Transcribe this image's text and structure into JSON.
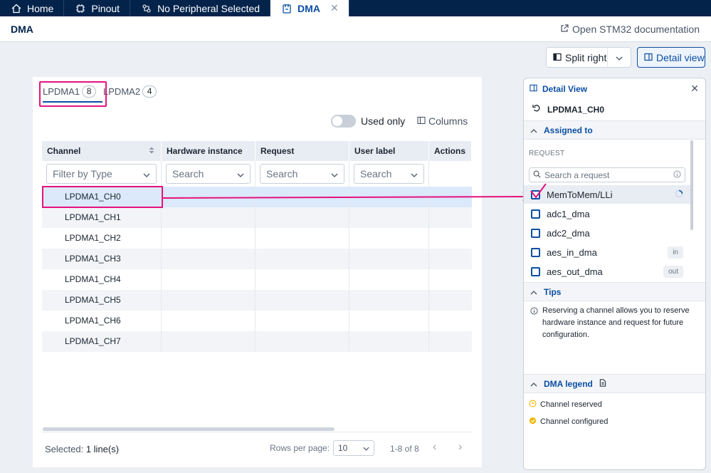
{
  "top_tabs": [
    {
      "label": "Home",
      "icon": "home-icon"
    },
    {
      "label": "Pinout",
      "icon": "chip-icon"
    },
    {
      "label": "No Peripheral Selected",
      "icon": "peripheral-icon"
    },
    {
      "label": "DMA",
      "icon": "dma-icon",
      "active": true
    }
  ],
  "page": {
    "title": "DMA",
    "doc_link": "Open STM32 documentation"
  },
  "toolbar": {
    "split_right": "Split right",
    "detail_view": "Detail view"
  },
  "subtabs": [
    {
      "label": "LPDMA1",
      "count": "8"
    },
    {
      "label": "LPDMA2",
      "count": "4"
    }
  ],
  "filters": {
    "used_only": "Used only",
    "columns": "Columns"
  },
  "table": {
    "headers": [
      "Channel",
      "Hardware instance",
      "Request",
      "User label",
      "Actions"
    ],
    "filter_placeholders": [
      "Filter by Type",
      "Search",
      "Search",
      "Search"
    ],
    "rows": [
      "LPDMA1_CH0",
      "LPDMA1_CH1",
      "LPDMA1_CH2",
      "LPDMA1_CH3",
      "LPDMA1_CH4",
      "LPDMA1_CH5",
      "LPDMA1_CH6",
      "LPDMA1_CH7"
    ],
    "selected_row": 0
  },
  "footer": {
    "selected_label": "Selected:",
    "selected_value": "1 line(s)",
    "rows_per_page_label": "Rows per page:",
    "rows_per_page": "10",
    "range": "1-8 of 8"
  },
  "detail": {
    "title": "Detail View",
    "channel": "LPDMA1_CH0",
    "assigned_to": "Assigned to",
    "request_label": "REQUEST",
    "search_placeholder": "Search a request",
    "requests": [
      {
        "name": "MemToMem/LLi",
        "tag": ""
      },
      {
        "name": "adc1_dma",
        "tag": ""
      },
      {
        "name": "adc2_dma",
        "tag": ""
      },
      {
        "name": "aes_in_dma",
        "tag": "in"
      },
      {
        "name": "aes_out_dma",
        "tag": "out"
      }
    ],
    "tips_title": "Tips",
    "tips_text": "Reserving a channel allows you to reserve hardware instance and request for future configuration.",
    "legend_title": "DMA legend",
    "legend": [
      {
        "label": "Channel reserved",
        "color": "#f2b705"
      },
      {
        "label": "Channel configured",
        "color": "#f2b705"
      }
    ]
  },
  "colors": {
    "brand_dark": "#03234b",
    "accent": "#0b4ea2",
    "highlight": "#e5127d"
  }
}
